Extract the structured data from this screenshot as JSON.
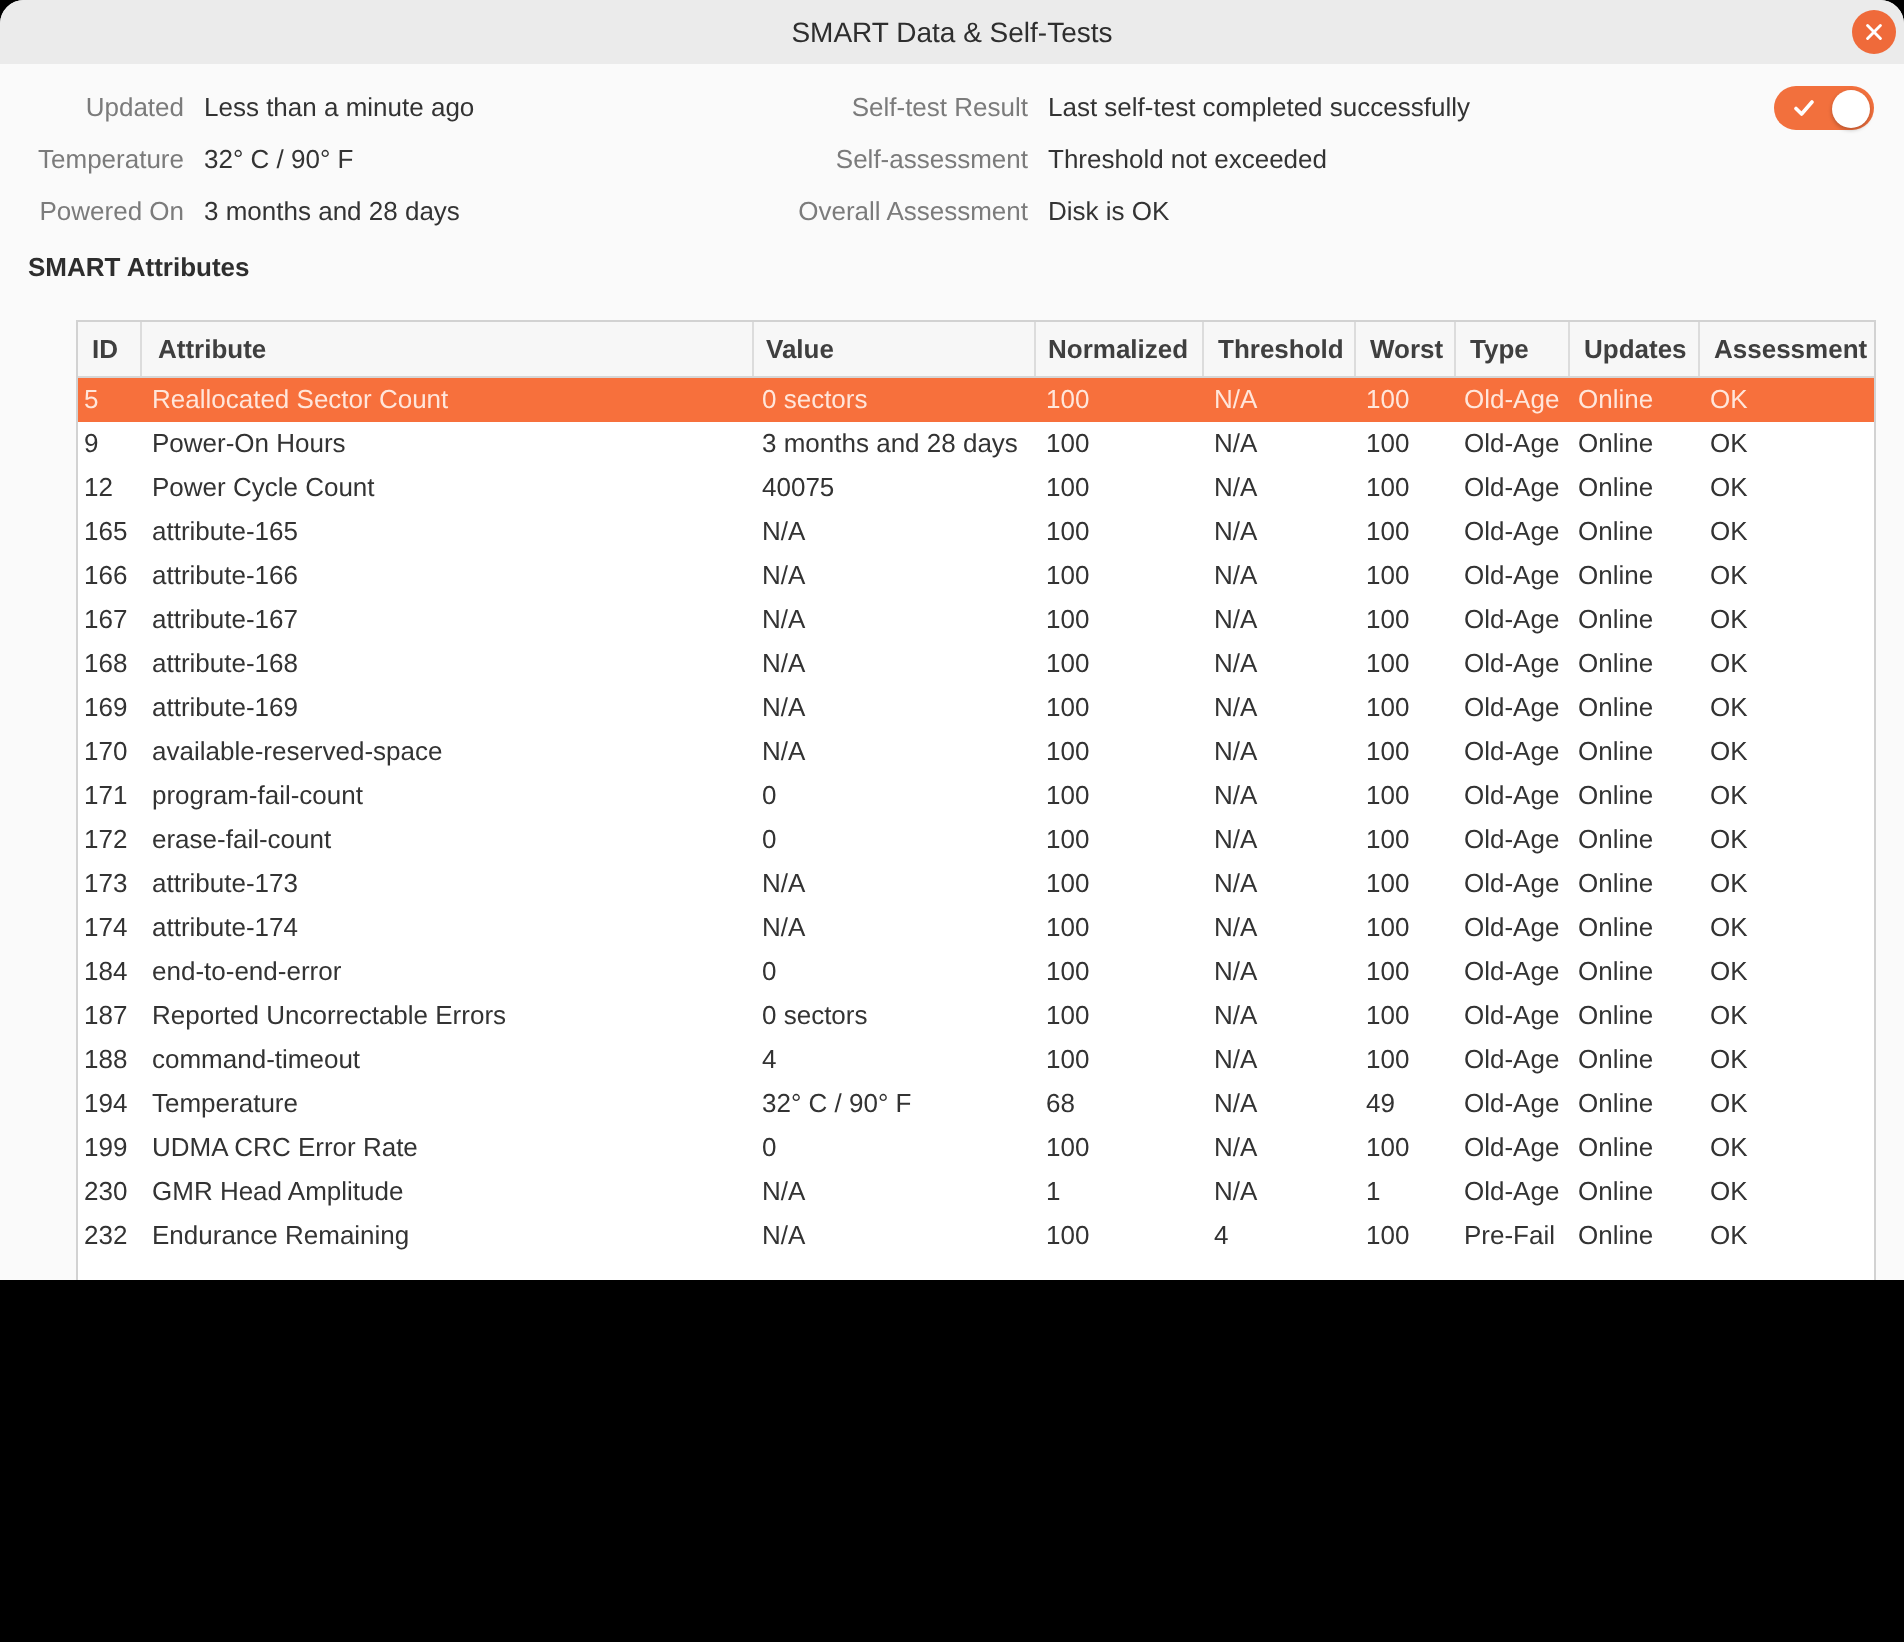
{
  "window": {
    "title": "SMART Data & Self-Tests"
  },
  "info_left": [
    {
      "label": "Updated",
      "value": "Less than a minute ago"
    },
    {
      "label": "Temperature",
      "value": "32° C / 90° F"
    },
    {
      "label": "Powered On",
      "value": "3 months and 28 days"
    }
  ],
  "info_right": [
    {
      "label": "Self-test Result",
      "value": "Last self-test completed successfully"
    },
    {
      "label": "Self-assessment",
      "value": "Threshold not exceeded"
    },
    {
      "label": "Overall Assessment",
      "value": "Disk is OK"
    }
  ],
  "switch": {
    "on": true
  },
  "section_title": "SMART Attributes",
  "table": {
    "columns": [
      "ID",
      "Attribute",
      "Value",
      "Normalized",
      "Threshold",
      "Worst",
      "Type",
      "Updates",
      "Assessment"
    ],
    "rows": [
      {
        "cells": [
          "5",
          "Reallocated Sector Count",
          "0 sectors",
          "100",
          "N/A",
          "100",
          "Old-Age",
          "Online",
          "OK"
        ],
        "selected": true
      },
      {
        "cells": [
          "9",
          "Power-On Hours",
          "3 months and 28 days",
          "100",
          "N/A",
          "100",
          "Old-Age",
          "Online",
          "OK"
        ],
        "selected": false
      },
      {
        "cells": [
          "12",
          "Power Cycle Count",
          "40075",
          "100",
          "N/A",
          "100",
          "Old-Age",
          "Online",
          "OK"
        ],
        "selected": false
      },
      {
        "cells": [
          "165",
          "attribute-165",
          "N/A",
          "100",
          "N/A",
          "100",
          "Old-Age",
          "Online",
          "OK"
        ],
        "selected": false
      },
      {
        "cells": [
          "166",
          "attribute-166",
          "N/A",
          "100",
          "N/A",
          "100",
          "Old-Age",
          "Online",
          "OK"
        ],
        "selected": false
      },
      {
        "cells": [
          "167",
          "attribute-167",
          "N/A",
          "100",
          "N/A",
          "100",
          "Old-Age",
          "Online",
          "OK"
        ],
        "selected": false
      },
      {
        "cells": [
          "168",
          "attribute-168",
          "N/A",
          "100",
          "N/A",
          "100",
          "Old-Age",
          "Online",
          "OK"
        ],
        "selected": false
      },
      {
        "cells": [
          "169",
          "attribute-169",
          "N/A",
          "100",
          "N/A",
          "100",
          "Old-Age",
          "Online",
          "OK"
        ],
        "selected": false
      },
      {
        "cells": [
          "170",
          "available-reserved-space",
          "N/A",
          "100",
          "N/A",
          "100",
          "Old-Age",
          "Online",
          "OK"
        ],
        "selected": false
      },
      {
        "cells": [
          "171",
          "program-fail-count",
          "0",
          "100",
          "N/A",
          "100",
          "Old-Age",
          "Online",
          "OK"
        ],
        "selected": false
      },
      {
        "cells": [
          "172",
          "erase-fail-count",
          "0",
          "100",
          "N/A",
          "100",
          "Old-Age",
          "Online",
          "OK"
        ],
        "selected": false
      },
      {
        "cells": [
          "173",
          "attribute-173",
          "N/A",
          "100",
          "N/A",
          "100",
          "Old-Age",
          "Online",
          "OK"
        ],
        "selected": false
      },
      {
        "cells": [
          "174",
          "attribute-174",
          "N/A",
          "100",
          "N/A",
          "100",
          "Old-Age",
          "Online",
          "OK"
        ],
        "selected": false
      },
      {
        "cells": [
          "184",
          "end-to-end-error",
          "0",
          "100",
          "N/A",
          "100",
          "Old-Age",
          "Online",
          "OK"
        ],
        "selected": false
      },
      {
        "cells": [
          "187",
          "Reported Uncorrectable Errors",
          "0 sectors",
          "100",
          "N/A",
          "100",
          "Old-Age",
          "Online",
          "OK"
        ],
        "selected": false
      },
      {
        "cells": [
          "188",
          "command-timeout",
          "4",
          "100",
          "N/A",
          "100",
          "Old-Age",
          "Online",
          "OK"
        ],
        "selected": false
      },
      {
        "cells": [
          "194",
          "Temperature",
          "32° C / 90° F",
          "68",
          "N/A",
          "49",
          "Old-Age",
          "Online",
          "OK"
        ],
        "selected": false
      },
      {
        "cells": [
          "199",
          "UDMA CRC Error Rate",
          "0",
          "100",
          "N/A",
          "100",
          "Old-Age",
          "Online",
          "OK"
        ],
        "selected": false
      },
      {
        "cells": [
          "230",
          "GMR Head Amplitude",
          "N/A",
          "1",
          "N/A",
          "1",
          "Old-Age",
          "Online",
          "OK"
        ],
        "selected": false
      },
      {
        "cells": [
          "232",
          "Endurance Remaining",
          "N/A",
          "100",
          "4",
          "100",
          "Pre-Fail",
          "Online",
          "OK"
        ],
        "selected": false
      }
    ]
  }
}
